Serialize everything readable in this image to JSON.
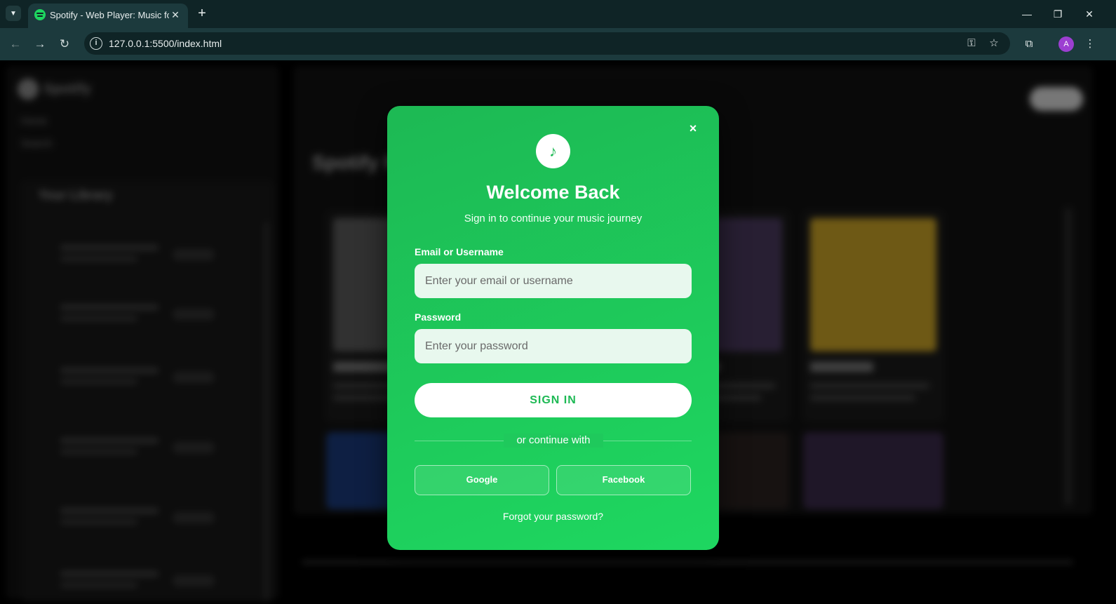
{
  "browser": {
    "tab_title": "Spotify - Web Player: Music for everyone",
    "url": "127.0.0.1:5500/index.html",
    "profile_initial": "A"
  },
  "background_page": {
    "logo_text": "Spotify",
    "nav": [
      "Home",
      "Search"
    ],
    "library_title": "Your Library",
    "heading": "Spotify Playlists"
  },
  "login_modal": {
    "logo_glyph": "♪",
    "title": "Welcome Back",
    "subtitle": "Sign in to continue your music journey",
    "email_label": "Email or Username",
    "email_placeholder": "Enter your email or username",
    "email_value": "",
    "password_label": "Password",
    "password_placeholder": "Enter your password",
    "password_value": "",
    "signin_label": "SIGN IN",
    "divider_text": "or continue with",
    "google_label": "Google",
    "facebook_label": "Facebook",
    "forgot_label": "Forgot your password?",
    "close_glyph": "×"
  },
  "colors": {
    "accent": "#1db954",
    "accent_light": "#1ed760",
    "chrome_bg": "#0f2426"
  },
  "icons": [
    "chevron-down-icon",
    "spotify-favicon-icon",
    "close-icon",
    "plus-icon",
    "minimize-icon",
    "restore-icon",
    "back-arrow-icon",
    "forward-arrow-icon",
    "reload-icon",
    "info-icon",
    "password-key-icon",
    "star-icon",
    "extensions-icon",
    "more-vert-icon",
    "music-note-icon"
  ]
}
